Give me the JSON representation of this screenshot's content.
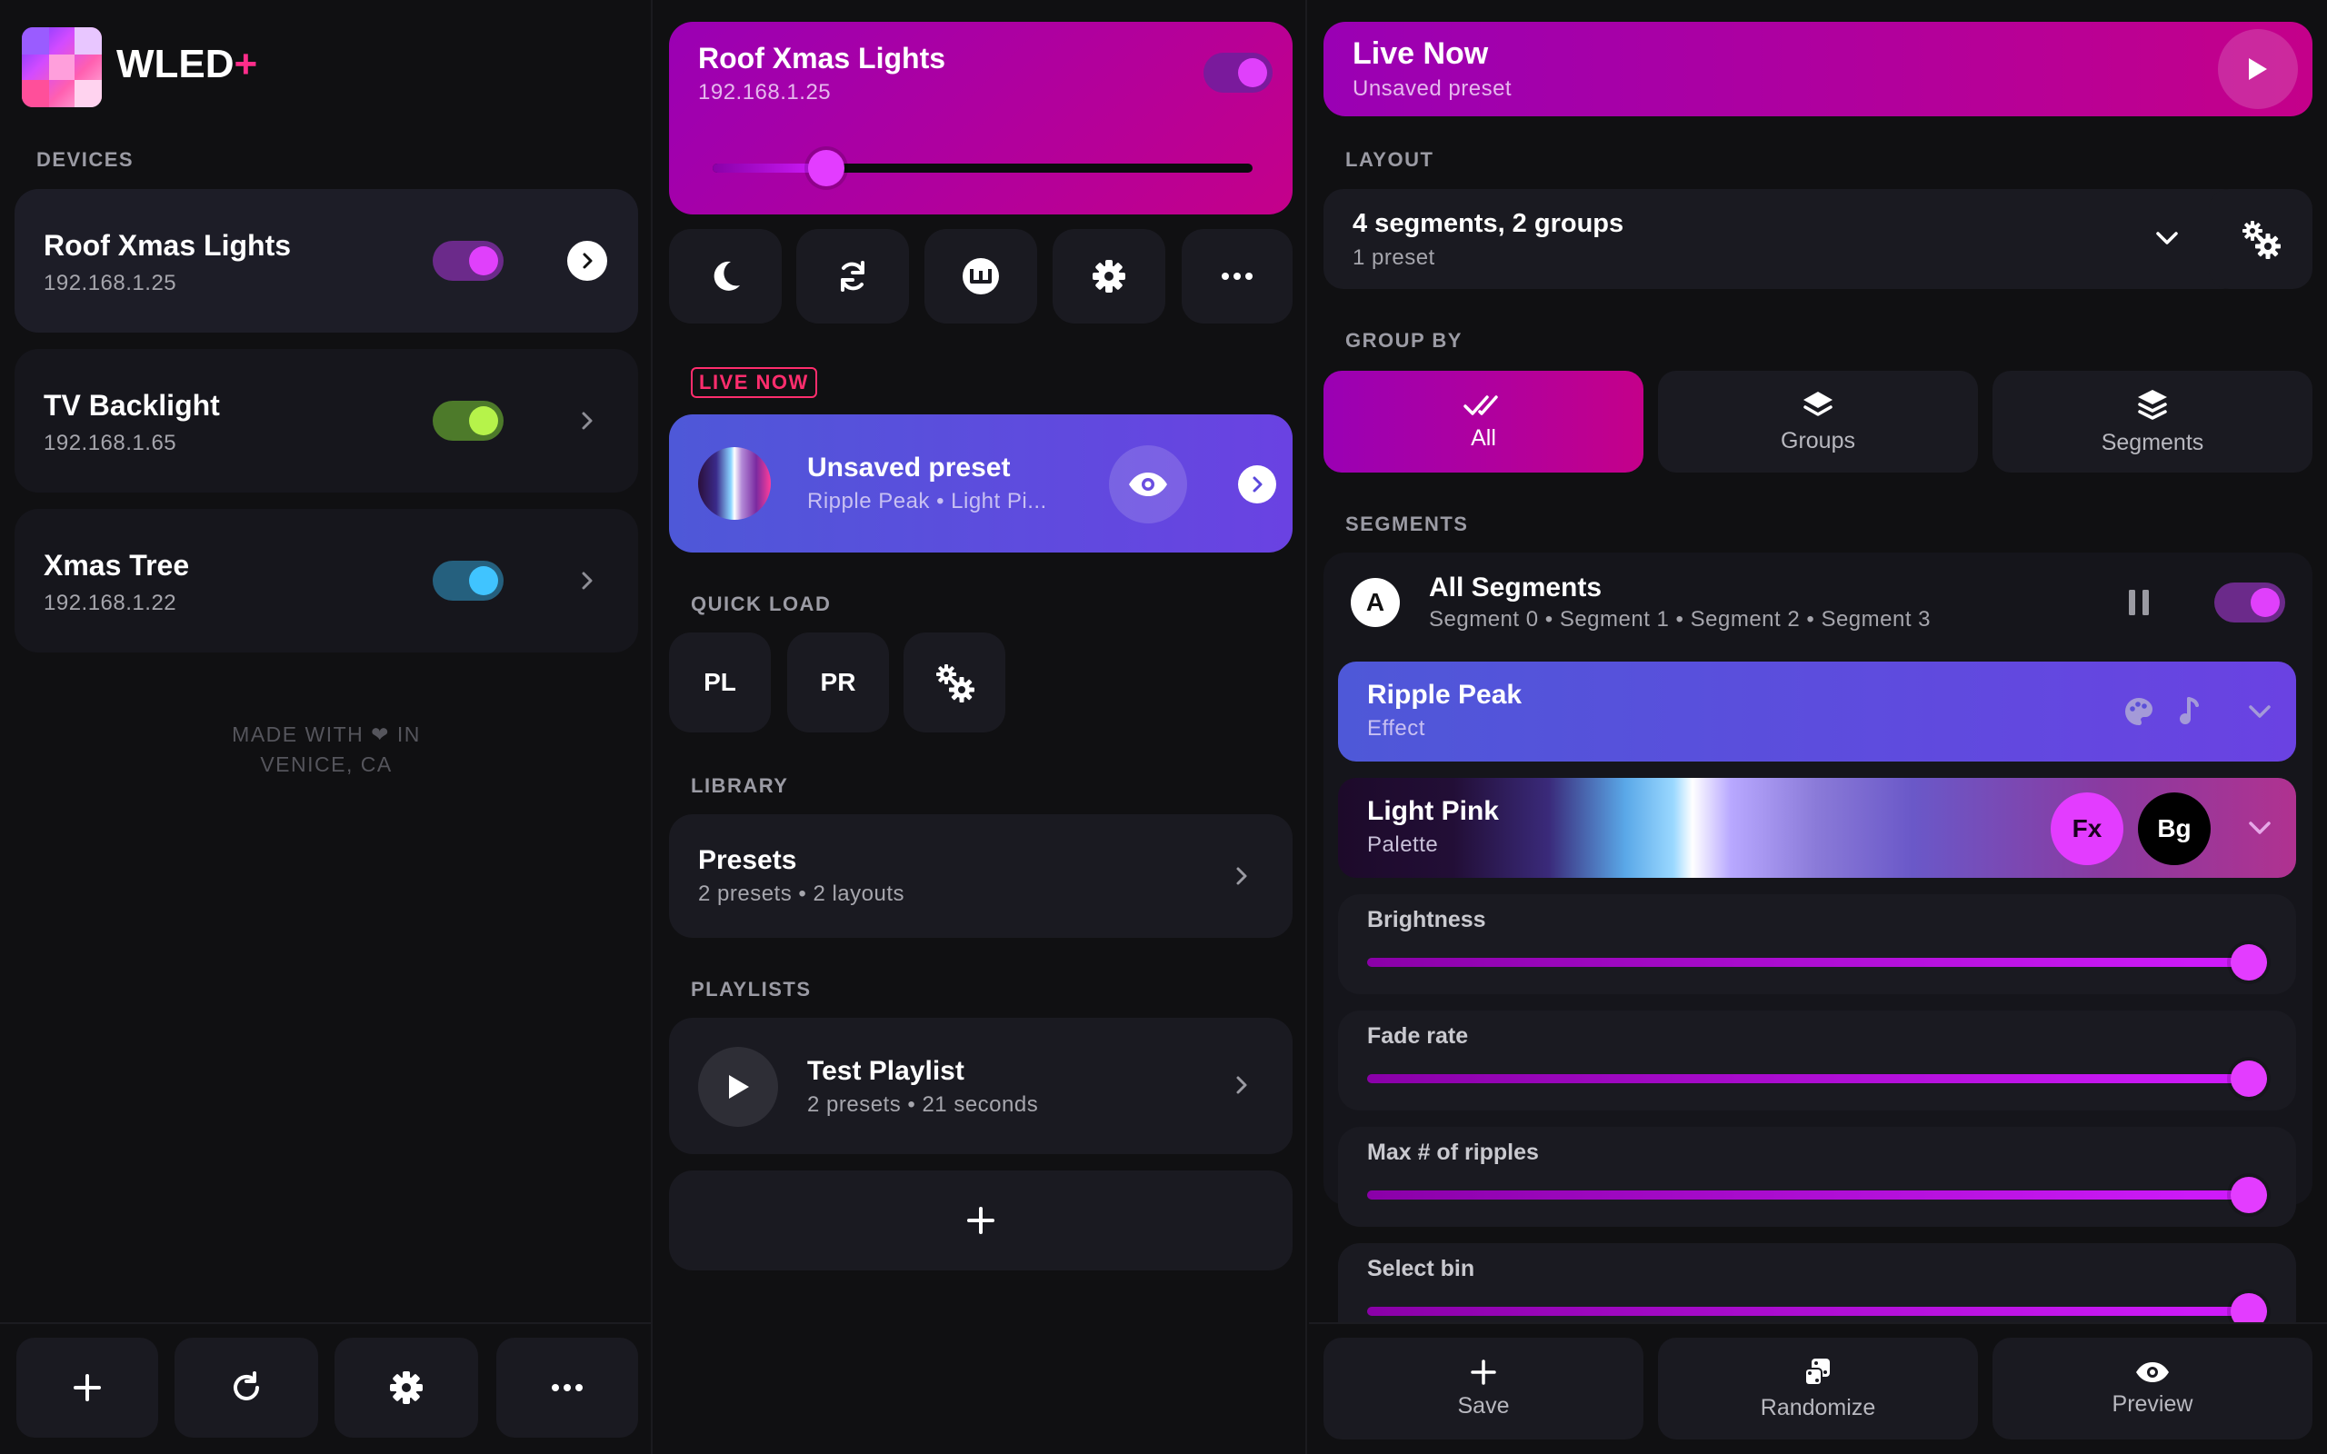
{
  "app": {
    "name": "WLED",
    "plus": "+"
  },
  "devices": {
    "section_label": "DEVICES",
    "items": [
      {
        "name": "Roof Xmas Lights",
        "ip": "192.168.1.25",
        "on": true,
        "color": "#e040fb",
        "track": "#6b2a8a"
      },
      {
        "name": "TV Backlight",
        "ip": "192.168.1.65",
        "on": true,
        "color": "#b6f34a",
        "track": "#4d7a2a"
      },
      {
        "name": "Xmas Tree",
        "ip": "192.168.1.22",
        "on": true,
        "color": "#40c4ff",
        "track": "#25607e"
      }
    ],
    "footer_line1": "MADE WITH ❤ IN",
    "footer_line2": "VENICE, CA"
  },
  "device_panel": {
    "name": "Roof Xmas Lights",
    "ip": "192.168.1.25",
    "brightness_fraction": 0.21,
    "live_now_label": "LIVE NOW",
    "live_preset": {
      "title": "Unsaved preset",
      "subtitle": "Ripple Peak • Light Pi..."
    },
    "quick_load_label": "QUICK LOAD",
    "quick_load": [
      "PL",
      "PR"
    ],
    "library_label": "LIBRARY",
    "library": {
      "title": "Presets",
      "subtitle": "2 presets • 2 layouts"
    },
    "playlists_label": "PLAYLISTS",
    "playlist": {
      "title": "Test Playlist",
      "subtitle": "2 presets • 21 seconds"
    }
  },
  "live": {
    "title": "Live Now",
    "subtitle": "Unsaved preset",
    "layout_label": "LAYOUT",
    "layout_title": "4 segments, 2 groups",
    "layout_subtitle": "1 preset",
    "group_by_label": "GROUP BY",
    "group_by": [
      "All",
      "Groups",
      "Segments"
    ],
    "segments_label": "SEGMENTS",
    "segment": {
      "badge": "A",
      "title": "All Segments",
      "subtitle": "Segment 0 • Segment 1 • Segment 2 • Segment 3"
    },
    "effect": {
      "title": "Ripple Peak",
      "subtitle": "Effect"
    },
    "palette": {
      "title": "Light Pink",
      "subtitle": "Palette",
      "fx": "Fx",
      "bg": "Bg"
    },
    "controls": [
      {
        "label": "Brightness",
        "value": 1.0
      },
      {
        "label": "Fade rate",
        "value": 1.0
      },
      {
        "label": "Max # of ripples",
        "value": 1.0
      },
      {
        "label": "Select bin",
        "value": 1.0
      }
    ],
    "actions": [
      "Save",
      "Randomize",
      "Preview"
    ]
  },
  "colors": {
    "accent": "#d21cff",
    "magenta": "#a0009c",
    "violet": "#5b3fd6"
  }
}
